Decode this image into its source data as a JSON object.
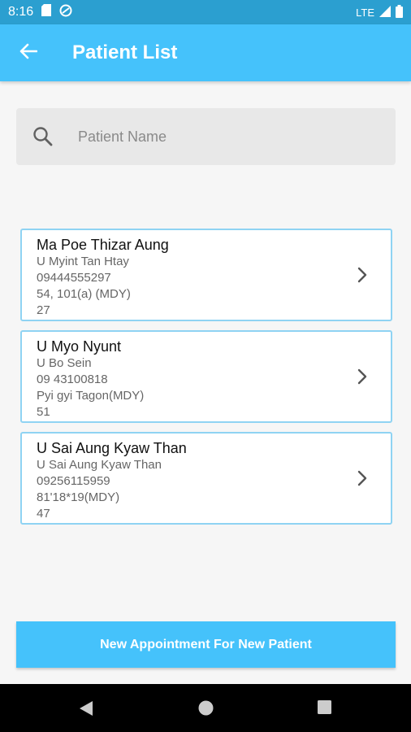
{
  "status_bar": {
    "time": "8:16",
    "network": "LTE"
  },
  "header": {
    "title": "Patient List"
  },
  "search": {
    "placeholder": "Patient Name",
    "value": ""
  },
  "patients": [
    {
      "name": "Ma Poe Thizar Aung",
      "guardian": "U Myint Tan Htay",
      "phone": "09444555297",
      "address": "54, 101(a) (MDY)",
      "age": "27"
    },
    {
      "name": "U Myo Nyunt",
      "guardian": "U Bo Sein",
      "phone": "09 43100818",
      "address": "Pyi gyi Tagon(MDY)",
      "age": "51"
    },
    {
      "name": "U Sai Aung Kyaw Than",
      "guardian": "U Sai Aung Kyaw Than",
      "phone": "09256115959",
      "address": "81'18*19(MDY)",
      "age": "47"
    }
  ],
  "actions": {
    "new_appointment_label": "New Appointment For New Patient"
  },
  "colors": {
    "primary": "#45c2fb",
    "status_bar": "#2b9fd0",
    "card_border": "#8fd3f3"
  },
  "icons": {
    "back": "arrow-left-icon",
    "search": "search-icon",
    "row": "chevron-right-icon"
  }
}
